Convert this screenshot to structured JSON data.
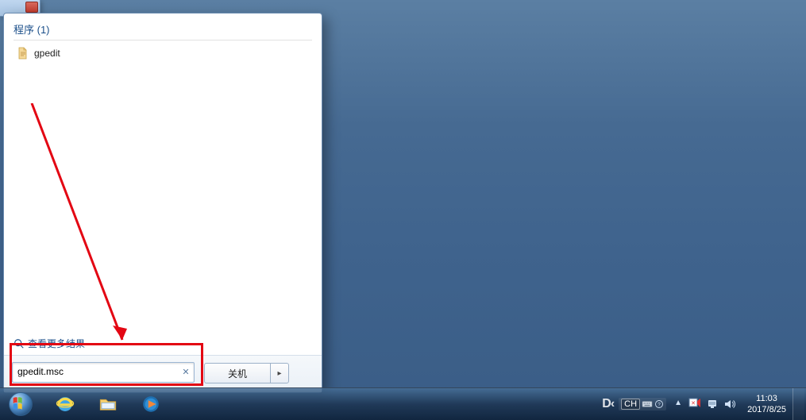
{
  "start_menu": {
    "programs_header": "程序 (1)",
    "results": [
      {
        "label": "gpedit"
      }
    ],
    "see_more": "查看更多结果",
    "search_value": "gpedit.msc",
    "shutdown_label": "关机"
  },
  "taskbar": {
    "ime_lang": "CH",
    "brand": "D‹",
    "clock_time": "11:03",
    "clock_date": "2017/8/25"
  }
}
